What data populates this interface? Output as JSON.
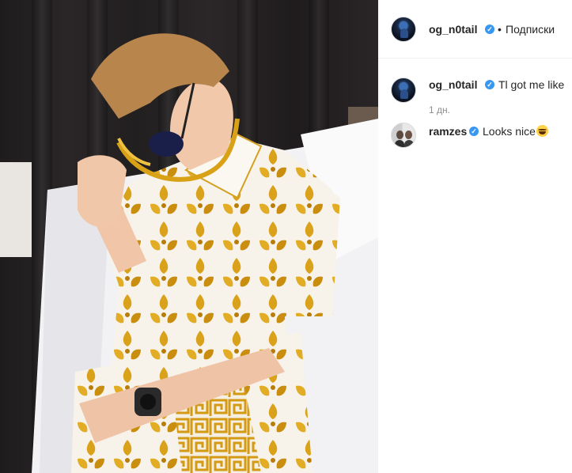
{
  "post": {
    "author": {
      "username": "og_n0tail",
      "verified": true,
      "follow_label": "Подписки",
      "separator": "•"
    },
    "photo": {
      "subject": "person in gold baroque shirt and sunglasses sitting on a bed"
    }
  },
  "comments": [
    {
      "username": "og_n0tail",
      "verified": true,
      "text": "Tl got me like",
      "time": "1 дн."
    },
    {
      "username": "ramzes",
      "verified": true,
      "text": "Looks nice",
      "emoji": "laughing-tears-emoji"
    }
  ],
  "colors": {
    "text": "#262626",
    "muted": "#8e8e8e",
    "verified_badge": "#3897f0",
    "divider": "#efefef"
  }
}
